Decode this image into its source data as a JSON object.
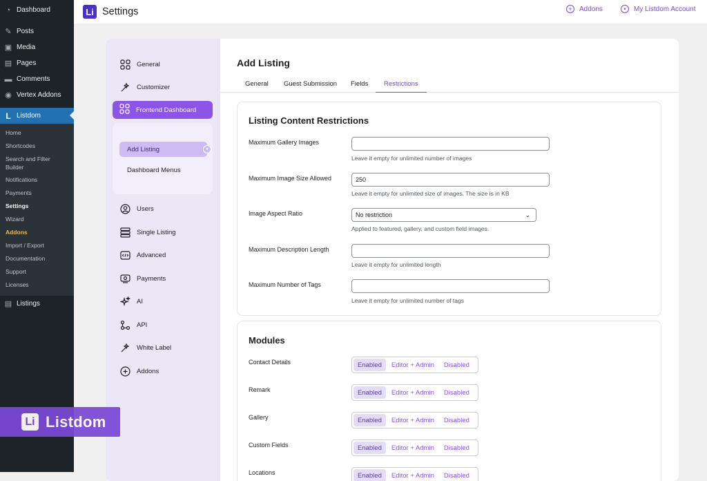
{
  "wp_sidebar": {
    "top_items": [
      {
        "label": "Dashboard",
        "icon": "dashboard-icon"
      },
      {
        "label": "Posts",
        "icon": "pin-icon"
      },
      {
        "label": "Media",
        "icon": "media-icon"
      },
      {
        "label": "Pages",
        "icon": "pages-icon"
      },
      {
        "label": "Comments",
        "icon": "comment-icon"
      },
      {
        "label": "Vertex Addons",
        "icon": "vertex-icon"
      }
    ],
    "active": {
      "label": "Listdom",
      "icon": "listdom-icon"
    },
    "submenu": [
      "Home",
      "Shortcodes",
      "Search and Filter Builder",
      "Notifications",
      "Payments",
      "Settings",
      "Wizard",
      "Addons",
      "Import / Export",
      "Documentation",
      "Support",
      "Licenses"
    ],
    "after": {
      "label": "Listings",
      "icon": "listings-icon"
    }
  },
  "logo_overlay": {
    "text": "Listdom",
    "mark": "Li"
  },
  "header": {
    "logo": "Li",
    "title": "Settings",
    "addons_link": "Addons",
    "account_link": "My Listdom Account"
  },
  "settings_nav": {
    "general": "General",
    "customizer": "Customizer",
    "frontend_dashboard": "Frontend Dashboard",
    "sub_add_listing": "Add Listing",
    "sub_dashboard_menus": "Dashboard Menus",
    "users": "Users",
    "single_listing": "Single Listing",
    "advanced": "Advanced",
    "payments": "Payments",
    "ai": "AI",
    "api": "API",
    "white_label": "White Label",
    "addons": "Addons"
  },
  "main": {
    "title": "Add Listing",
    "tabs": [
      "General",
      "Guest Submission",
      "Fields",
      "Restrictions"
    ],
    "active_tab": "Restrictions"
  },
  "restrictions": {
    "heading": "Listing Content Restrictions",
    "fields": [
      {
        "label": "Maximum Gallery Images",
        "value": "",
        "help": "Leave it empty for unlimited number of images"
      },
      {
        "label": "Maximum Image Size Allowed",
        "value": "250",
        "help": "Leave it empty for unlimited size of images. The size is in KB"
      },
      {
        "label": "Image Aspect Ratio",
        "value": "No restriction",
        "help": "Applied to featured, gallery, and custom field images."
      },
      {
        "label": "Maximum Description Length",
        "value": "",
        "help": "Leave it empty for unlimited length"
      },
      {
        "label": "Maximum Number of Tags",
        "value": "",
        "help": "Leave it empty for unlimited number of tags"
      }
    ]
  },
  "modules": {
    "heading": "Modules",
    "options": [
      "Enabled",
      "Editor + Admin",
      "Disabled"
    ],
    "items": [
      {
        "label": "Contact Details",
        "selected": "Enabled"
      },
      {
        "label": "Remark",
        "selected": "Enabled"
      },
      {
        "label": "Gallery",
        "selected": "Enabled"
      },
      {
        "label": "Custom Fields",
        "selected": "Enabled"
      },
      {
        "label": "Locations",
        "selected": "Enabled"
      }
    ]
  },
  "colors": {
    "accent": "#8c55e6",
    "wp_sidebar": "#1d2327",
    "wp_active": "#2271b1"
  }
}
